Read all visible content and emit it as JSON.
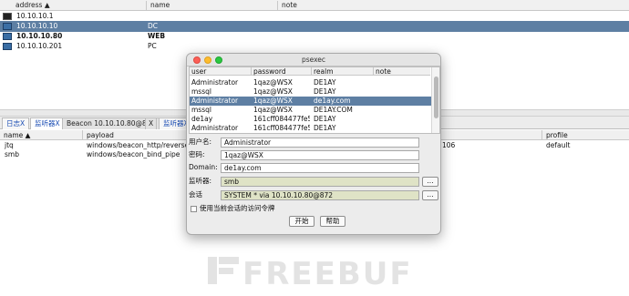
{
  "targets": {
    "columns": [
      "address ▲",
      "name",
      "note"
    ],
    "rows": [
      {
        "address": "10.10.10.1",
        "name": "",
        "icon": "monitor-icon"
      },
      {
        "address": "10.10.10.10",
        "name": "DC",
        "icon": "server-icon"
      },
      {
        "address": "10.10.10.80",
        "name": "WEB",
        "icon": "server-icon"
      },
      {
        "address": "10.10.10.201",
        "name": "PC",
        "icon": "server-icon"
      }
    ]
  },
  "tabs": [
    {
      "label": "日志X"
    },
    {
      "label": "监听器X"
    },
    {
      "label": "Beacon 10.10.10.80@872"
    },
    {
      "label": "X"
    },
    {
      "label": "监听器X"
    }
  ],
  "listeners": {
    "columns": [
      "name ▲",
      "payload",
      "profile"
    ],
    "rows": [
      {
        "name": "jtq",
        "payload": "windows/beacon_http/reverse_http",
        "extra": "106",
        "profile": "default"
      },
      {
        "name": "smb",
        "payload": "windows/beacon_bind_pipe",
        "extra": "",
        "profile": ""
      }
    ]
  },
  "dialog": {
    "title": "psexec",
    "cred_columns": [
      "user",
      "password",
      "realm",
      "note"
    ],
    "cred_rows": [
      {
        "user": "Administrator",
        "password": "1qaz@WSX",
        "realm": "DE1AY"
      },
      {
        "user": "mssql",
        "password": "1qaz@WSX",
        "realm": "DE1AY"
      },
      {
        "user": "Administrator",
        "password": "1qaz@WSX",
        "realm": "de1ay.com"
      },
      {
        "user": "mssql",
        "password": "1qaz@WSX",
        "realm": "DE1AY.COM"
      },
      {
        "user": "de1ay",
        "password": "161cff084477fe5...",
        "realm": "DE1AY"
      },
      {
        "user": "Administrator",
        "password": "161cff084477fe5...",
        "realm": "DE1AY"
      }
    ],
    "form": {
      "user_label": "用户名:",
      "user_value": "Administrator",
      "pass_label": "密码:",
      "pass_value": "1qaz@WSX",
      "domain_label": "Domain:",
      "domain_value": "de1ay.com",
      "listener_label": "监听器:",
      "listener_value": "smb",
      "session_label": "会话",
      "session_value": "SYSTEM * via  10.10.10.80@872",
      "checkbox_label": "使用当前会话的访问令牌",
      "ellipsis": "...",
      "start_label": "开始",
      "help_label": "帮助"
    }
  },
  "watermark": {
    "text": "FREEBUF"
  },
  "colors": {
    "selection": "#5e7fa3",
    "tab_blue": "#1d4fb5",
    "readonly_field": "#dfe3c6"
  }
}
